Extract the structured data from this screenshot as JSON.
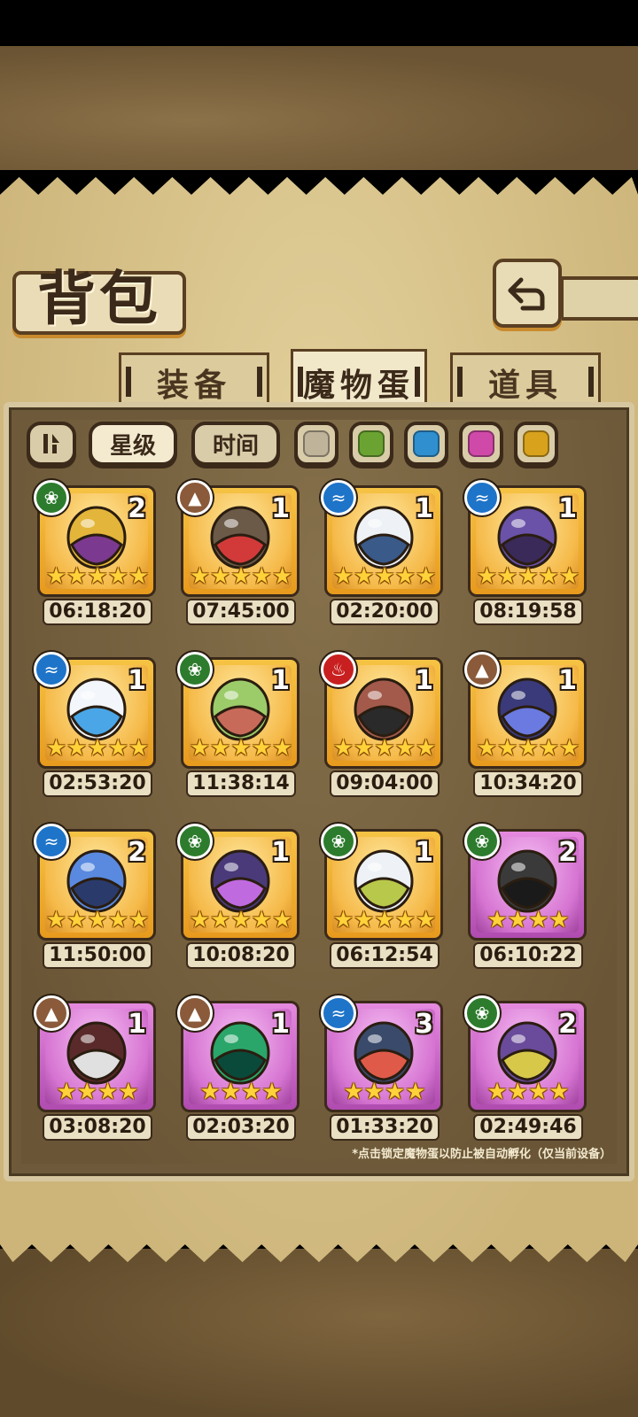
{
  "screen": {
    "title": "背包"
  },
  "tabs": [
    {
      "label": "装备",
      "active": false
    },
    {
      "label": "魔物蛋",
      "active": true
    },
    {
      "label": "道具",
      "active": false
    }
  ],
  "filters": {
    "sort_star": "星级",
    "sort_time": "时间",
    "colors": [
      "#bfb39a",
      "#6aa332",
      "#2f8fcf",
      "#cf4aa8",
      "#d8a21c"
    ]
  },
  "eggs": [
    {
      "count": "2",
      "timer": "06:18:20",
      "element": "grass",
      "rarity": "gold",
      "stars": "★★★★★",
      "icon": "genie-lamp-icon"
    },
    {
      "count": "1",
      "timer": "07:45:00",
      "element": "earth",
      "rarity": "gold",
      "stars": "★★★★★",
      "icon": "pyramid-icon"
    },
    {
      "count": "1",
      "timer": "02:20:00",
      "element": "water",
      "rarity": "gold",
      "stars": "★★★★★",
      "icon": "shield-egg-icon"
    },
    {
      "count": "1",
      "timer": "08:19:58",
      "element": "water",
      "rarity": "gold",
      "stars": "★★★★★",
      "icon": "clock-egg-icon"
    },
    {
      "count": "1",
      "timer": "02:53:20",
      "element": "water",
      "rarity": "gold",
      "stars": "★★★★★",
      "icon": "heart-egg-icon"
    },
    {
      "count": "1",
      "timer": "11:38:14",
      "element": "grass",
      "rarity": "gold",
      "stars": "★★★★★",
      "icon": "green-egg-icon"
    },
    {
      "count": "1",
      "timer": "09:04:00",
      "element": "fire",
      "rarity": "gold",
      "stars": "★★★★★",
      "icon": "armored-egg-icon"
    },
    {
      "count": "1",
      "timer": "10:34:20",
      "element": "earth",
      "rarity": "gold",
      "stars": "★★★★★",
      "icon": "crystal-egg-icon"
    },
    {
      "count": "2",
      "timer": "11:50:00",
      "element": "water",
      "rarity": "gold",
      "stars": "★★★★★",
      "icon": "fang-egg-icon"
    },
    {
      "count": "1",
      "timer": "10:08:20",
      "element": "grass",
      "rarity": "gold",
      "stars": "★★★★★",
      "icon": "dark-egg-icon"
    },
    {
      "count": "1",
      "timer": "06:12:54",
      "element": "grass",
      "rarity": "gold",
      "stars": "★★★★★",
      "icon": "wing-egg-icon"
    },
    {
      "count": "2",
      "timer": "06:10:22",
      "element": "grass",
      "rarity": "purple",
      "stars": "★★★★",
      "icon": "trident-icon"
    },
    {
      "count": "1",
      "timer": "03:08:20",
      "element": "earth",
      "rarity": "purple",
      "stars": "★★★★",
      "icon": "horn-egg-icon"
    },
    {
      "count": "1",
      "timer": "02:03:20",
      "element": "earth",
      "rarity": "purple",
      "stars": "★★★★",
      "icon": "orb-egg-icon"
    },
    {
      "count": "3",
      "timer": "01:33:20",
      "element": "water",
      "rarity": "purple",
      "stars": "★★★★",
      "icon": "shell-egg-icon"
    },
    {
      "count": "2",
      "timer": "02:49:46",
      "element": "grass",
      "rarity": "purple",
      "stars": "★★★★",
      "icon": "moth-egg-icon"
    }
  ],
  "footnote": "*点击锁定魔物蛋以防止被自动孵化（仅当前设备）"
}
